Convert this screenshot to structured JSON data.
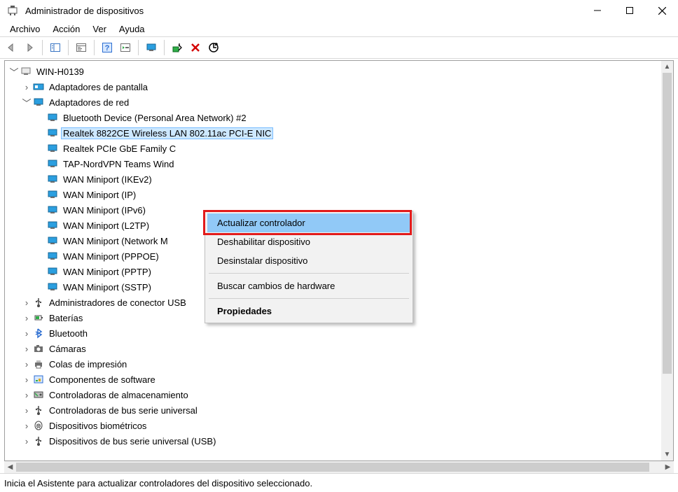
{
  "window": {
    "title": "Administrador de dispositivos"
  },
  "menubar": {
    "items": [
      "Archivo",
      "Acción",
      "Ver",
      "Ayuda"
    ]
  },
  "tree": {
    "root": "WIN-H0139",
    "display_adapters": "Adaptadores de pantalla",
    "network_adapters": "Adaptadores de red",
    "net_children": [
      "Bluetooth Device (Personal Area Network) #2",
      "Realtek 8822CE Wireless LAN 802.11ac PCI-E NIC",
      "Realtek PCIe GbE Family C",
      "TAP-NordVPN Teams Wind",
      "WAN Miniport (IKEv2)",
      "WAN Miniport (IP)",
      "WAN Miniport (IPv6)",
      "WAN Miniport (L2TP)",
      "WAN Miniport (Network M",
      "WAN Miniport (PPPOE)",
      "WAN Miniport (PPTP)",
      "WAN Miniport (SSTP)"
    ],
    "categories_after": [
      {
        "label": "Administradores de conector USB",
        "icon": "usb"
      },
      {
        "label": "Baterías",
        "icon": "battery"
      },
      {
        "label": "Bluetooth",
        "icon": "bluetooth"
      },
      {
        "label": "Cámaras",
        "icon": "camera"
      },
      {
        "label": "Colas de impresión",
        "icon": "printer"
      },
      {
        "label": "Componentes de software",
        "icon": "software"
      },
      {
        "label": "Controladoras de almacenamiento",
        "icon": "storage"
      },
      {
        "label": "Controladoras de bus serie universal",
        "icon": "usb"
      },
      {
        "label": "Dispositivos biométricos",
        "icon": "biometric"
      },
      {
        "label": "Dispositivos de bus serie universal (USB)",
        "icon": "usb"
      }
    ]
  },
  "context_menu": {
    "items": [
      {
        "label": "Actualizar controlador",
        "hover": true
      },
      {
        "label": "Deshabilitar dispositivo"
      },
      {
        "label": "Desinstalar dispositivo"
      },
      {
        "sep": true
      },
      {
        "label": "Buscar cambios de hardware"
      },
      {
        "sep": true
      },
      {
        "label": "Propiedades",
        "bold": true
      }
    ]
  },
  "statusbar": {
    "text": "Inicia el Asistente para actualizar controladores del dispositivo seleccionado."
  }
}
